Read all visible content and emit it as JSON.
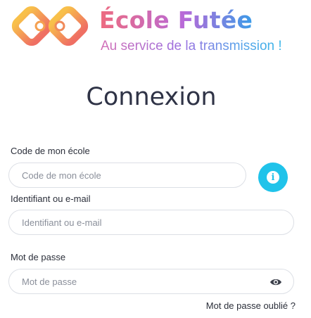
{
  "brand": {
    "name": "École Futée",
    "tagline": "Au service de la transmission !"
  },
  "page": {
    "title": "Connexion"
  },
  "form": {
    "school_code": {
      "label": "Code de mon école",
      "placeholder": "Code de mon école",
      "value": ""
    },
    "identifier": {
      "label": "Identifiant ou e-mail",
      "placeholder": "Identifiant ou e-mail",
      "value": ""
    },
    "password": {
      "label": "Mot de passe",
      "placeholder": "Mot de passe",
      "value": ""
    },
    "forgot_password": "Mot de passe oublié ?"
  },
  "icons": {
    "info": "info-icon",
    "eye": "eye-icon",
    "logo": "linked-squares-logo"
  },
  "colors": {
    "info_button": "#20c3ea",
    "logo_start": "#f8b44c",
    "logo_end": "#ef7a60"
  }
}
